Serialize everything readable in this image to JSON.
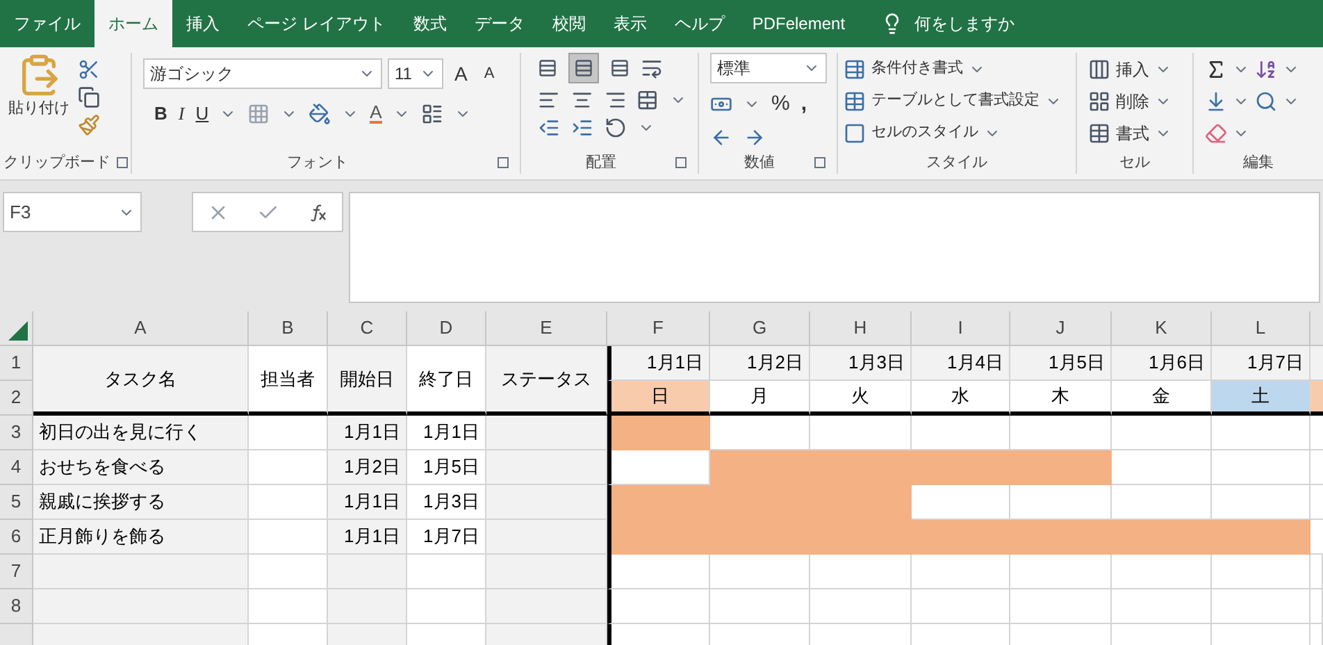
{
  "tabs": [
    {
      "label": "ファイル",
      "selected": false
    },
    {
      "label": "ホーム",
      "selected": true
    },
    {
      "label": "挿入",
      "selected": false
    },
    {
      "label": "ページ レイアウト",
      "selected": false
    },
    {
      "label": "数式",
      "selected": false
    },
    {
      "label": "データ",
      "selected": false
    },
    {
      "label": "校閲",
      "selected": false
    },
    {
      "label": "表示",
      "selected": false
    },
    {
      "label": "ヘルプ",
      "selected": false
    },
    {
      "label": "PDFelement",
      "selected": false
    }
  ],
  "tell_me": "何をしますか",
  "ribbon": {
    "clipboard": {
      "label": "クリップボード",
      "paste": "貼り付け"
    },
    "font": {
      "label": "フォント",
      "font_name": "游ゴシック",
      "font_size": "11",
      "grow": "A",
      "shrink": "A",
      "bold": "B",
      "italic": "I",
      "underline": "U",
      "font_color": "A"
    },
    "alignment": {
      "label": "配置",
      "vertical": [
        {
          "selected": false
        },
        {
          "selected": true
        },
        {
          "selected": false
        }
      ]
    },
    "number": {
      "label": "数値",
      "format": "標準",
      "percent": "%",
      "comma": ","
    },
    "styles": {
      "label": "スタイル",
      "items": [
        "条件付き書式",
        "テーブルとして書式設定",
        "セルのスタイル"
      ]
    },
    "cells": {
      "label": "セル",
      "items": [
        "挿入",
        "削除",
        "書式"
      ]
    },
    "editing": {
      "label": "編集"
    }
  },
  "name_box": "F3",
  "columns": [
    "A",
    "B",
    "C",
    "D",
    "E",
    "F",
    "G",
    "H",
    "I",
    "J",
    "K",
    "L"
  ],
  "row_numbers": [
    "1",
    "2",
    "3",
    "4",
    "5",
    "6",
    "7",
    "8"
  ],
  "headers": {
    "task": "タスク名",
    "owner": "担当者",
    "start": "開始日",
    "end": "終了日",
    "status": "ステータス"
  },
  "days": [
    {
      "date": "1月1日",
      "weekday": "日",
      "kind": "sunday"
    },
    {
      "date": "1月2日",
      "weekday": "月",
      "kind": "weekday"
    },
    {
      "date": "1月3日",
      "weekday": "火",
      "kind": "weekday"
    },
    {
      "date": "1月4日",
      "weekday": "水",
      "kind": "weekday"
    },
    {
      "date": "1月5日",
      "weekday": "木",
      "kind": "weekday"
    },
    {
      "date": "1月6日",
      "weekday": "金",
      "kind": "weekday"
    },
    {
      "date": "1月7日",
      "weekday": "土",
      "kind": "saturday"
    }
  ],
  "cut_column": {
    "kind": "sunday"
  },
  "tasks": [
    {
      "name": "初日の出を見に行く",
      "start": "1月1日",
      "end": "1月1日",
      "bars": [
        true,
        false,
        false,
        false,
        false,
        false,
        false
      ]
    },
    {
      "name": "おせちを食べる",
      "start": "1月2日",
      "end": "1月5日",
      "bars": [
        false,
        true,
        true,
        true,
        true,
        false,
        false
      ]
    },
    {
      "name": "親戚に挨拶する",
      "start": "1月1日",
      "end": "1月3日",
      "bars": [
        true,
        true,
        true,
        false,
        false,
        false,
        false
      ]
    },
    {
      "name": "正月飾りを飾る",
      "start": "1月1日",
      "end": "1月7日",
      "bars": [
        true,
        true,
        true,
        true,
        true,
        true,
        true
      ]
    }
  ]
}
